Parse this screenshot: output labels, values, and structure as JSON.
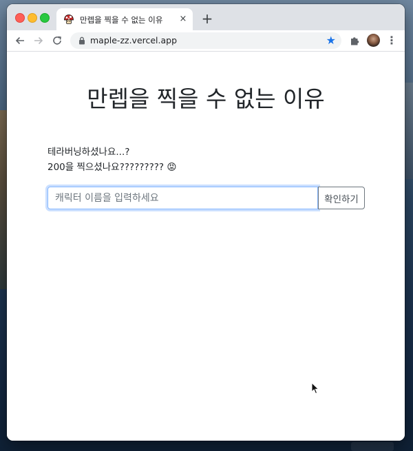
{
  "browser": {
    "tab": {
      "title": "만렙을 찍을 수 없는 이유",
      "close": "×"
    },
    "new_tab": "+",
    "url": "maple-zz.vercel.app"
  },
  "page": {
    "title": "만렙을 찍을 수 없는 이유",
    "line1": "테라버닝하셨나요...?",
    "line2": "200을 찍으셨나요????????? 😡",
    "search": {
      "placeholder": "캐릭터 이름을 입력하세요",
      "value": ""
    },
    "confirm_label": "확인하기"
  },
  "colors": {
    "focus_border": "#86b7fe",
    "bookmark_star": "#1a73e8",
    "title_text": "#212529"
  },
  "icons": [
    "mushroom-favicon-icon",
    "close-icon",
    "plus-icon",
    "back-arrow-icon",
    "forward-arrow-icon",
    "reload-icon",
    "lock-icon",
    "star-icon",
    "puzzle-extension-icon",
    "avatar",
    "kebab-menu-icon",
    "mouse-cursor-icon"
  ]
}
